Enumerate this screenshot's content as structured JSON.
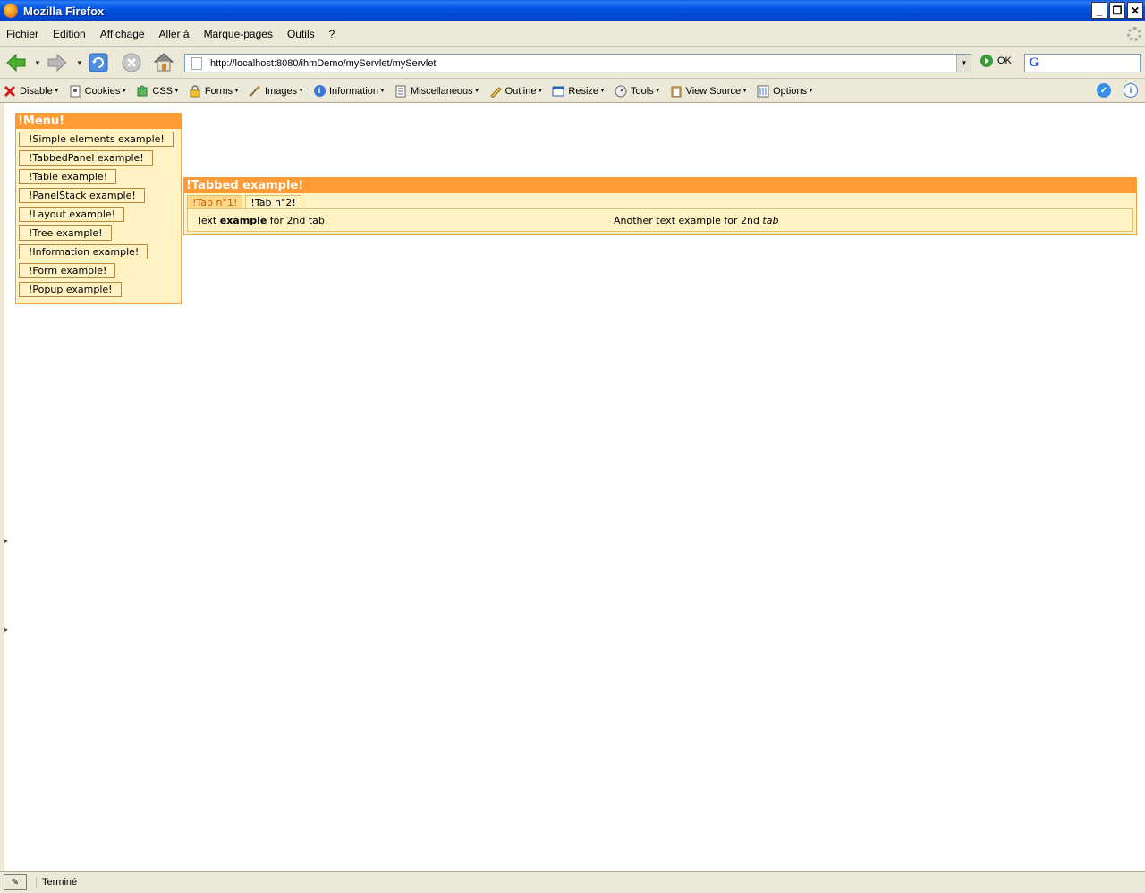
{
  "window": {
    "title": "Mozilla Firefox",
    "minimize": "_",
    "restore": "❐",
    "close": "✕"
  },
  "menubar": {
    "items": [
      "Fichier",
      "Edition",
      "Affichage",
      "Aller à",
      "Marque-pages",
      "Outils",
      "?"
    ]
  },
  "navbar": {
    "url": "http://localhost:8080/ihmDemo/myServlet/myServlet",
    "go_label": "OK",
    "search_value": ""
  },
  "devbar": {
    "items": [
      "Disable",
      "Cookies",
      "CSS",
      "Forms",
      "Images",
      "Information",
      "Miscellaneous",
      "Outline",
      "Resize",
      "Tools",
      "View Source",
      "Options"
    ]
  },
  "menu_panel": {
    "title": "!Menu!",
    "items": [
      "!Simple elements example!",
      "!TabbedPanel example!",
      "!Table example!",
      "!PanelStack example!",
      "!Layout example!",
      "!Tree example!",
      "!Information example!",
      "!Form example!",
      "!Popup example!"
    ]
  },
  "tabbed_panel": {
    "title": "!Tabbed example!",
    "tabs": [
      "!Tab n°1!",
      "!Tab n°2!"
    ],
    "active_tab": 1,
    "content": {
      "left_pre": "Text ",
      "left_bold": "example",
      "left_post": " for 2nd tab",
      "right_pre": "Another text example for 2nd ",
      "right_italic": "tab"
    }
  },
  "statusbar": {
    "text": "Terminé"
  },
  "colors": {
    "panel_header": "#ff9b34",
    "panel_body": "#fff3c4",
    "titlebar": "#0053e0",
    "chrome": "#ece9d8"
  }
}
